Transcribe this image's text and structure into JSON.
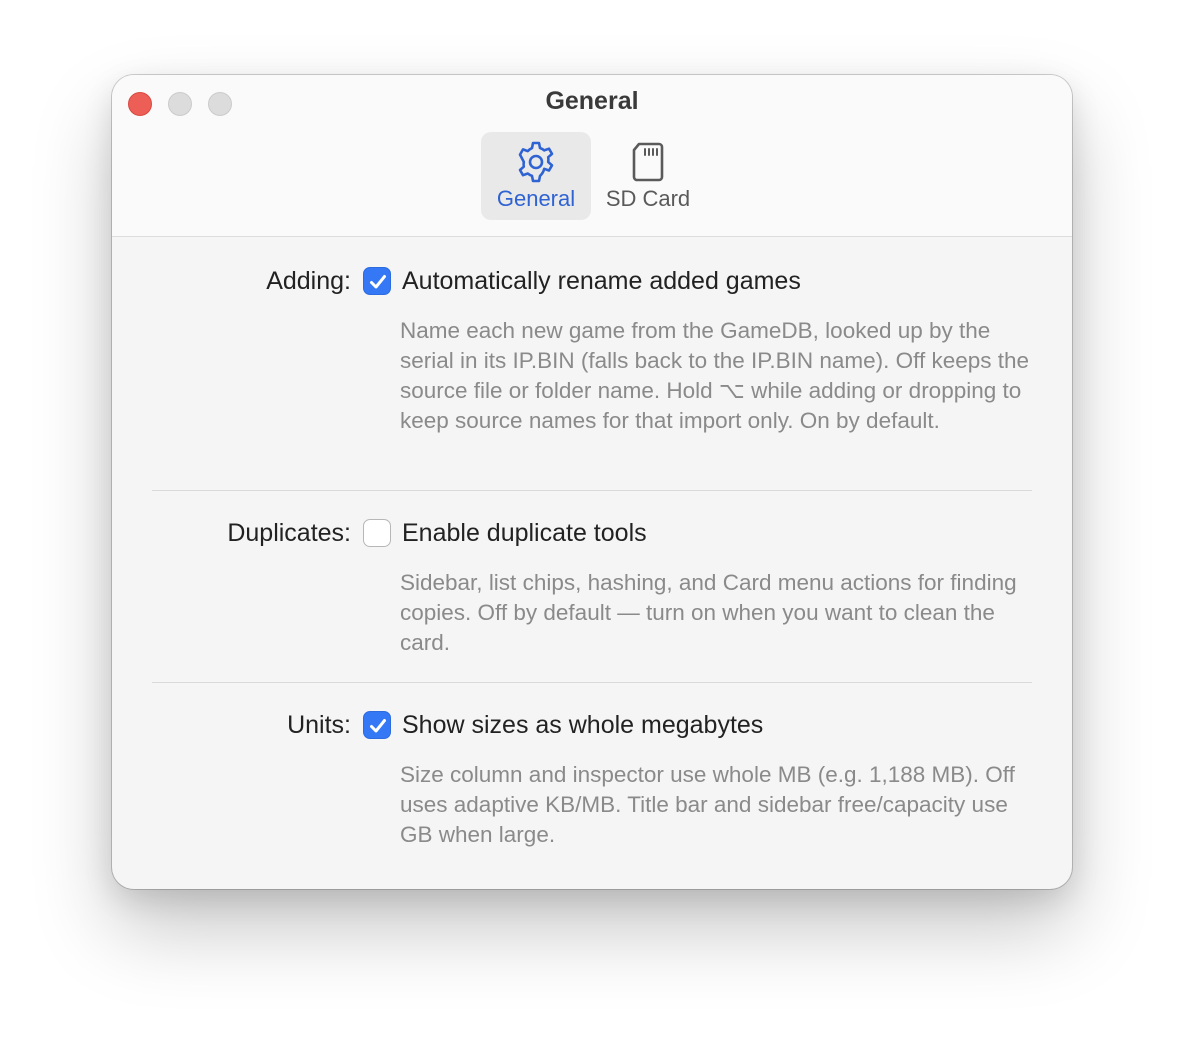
{
  "window": {
    "title": "General"
  },
  "toolbar": {
    "tabs": [
      {
        "label": "General",
        "icon": "gear-icon",
        "selected": true
      },
      {
        "label": "SD Card",
        "icon": "sd-card-icon",
        "selected": false
      }
    ]
  },
  "settings": [
    {
      "section": "Adding:",
      "option": "Automatically rename added games",
      "checked": true,
      "description": "Name each new game from the GameDB, looked up by the serial in its IP.BIN (falls back to the IP.BIN name). Off keeps the source file or folder name. Hold ⌥ while adding or dropping to keep source names for that import only. On by default."
    },
    {
      "section": "Duplicates:",
      "option": "Enable duplicate tools",
      "checked": false,
      "description": "Sidebar, list chips, hashing, and Card menu actions for finding copies. Off by default — turn on when you want to clean the card."
    },
    {
      "section": "Units:",
      "option": "Show sizes as whole megabytes",
      "checked": true,
      "description": "Size column and inspector use whole MB (e.g. 1,188 MB). Off uses adaptive KB/MB. Title bar and sidebar free/capacity use GB when large."
    }
  ],
  "colors": {
    "accent": "#3478f6",
    "close": "#ed5f56",
    "selected_tab_text": "#2f63d3"
  }
}
